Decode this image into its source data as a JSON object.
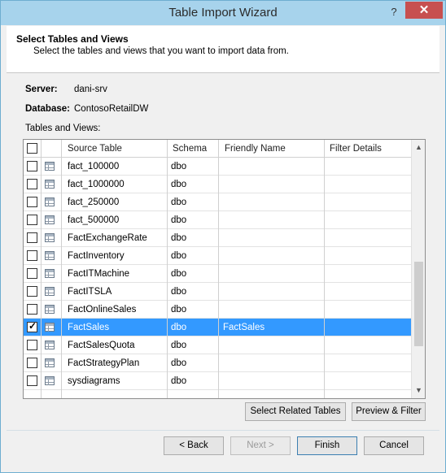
{
  "window": {
    "title": "Table Import Wizard",
    "help_glyph": "?",
    "close_glyph": "✕"
  },
  "header": {
    "title": "Select Tables and Views",
    "subtitle": "Select the tables and views that you want to import data from."
  },
  "server": {
    "label": "Server:",
    "value": "dani-srv"
  },
  "database": {
    "label": "Database:",
    "value": "ContosoRetailDW"
  },
  "tables_label": "Tables and Views:",
  "grid": {
    "columns": [
      "Source Table",
      "Schema",
      "Friendly Name",
      "Filter Details"
    ],
    "rows": [
      {
        "source": "fact_100000",
        "schema": "dbo",
        "friendly": "",
        "filter": "",
        "checked": false,
        "selected": false
      },
      {
        "source": "fact_1000000",
        "schema": "dbo",
        "friendly": "",
        "filter": "",
        "checked": false,
        "selected": false
      },
      {
        "source": "fact_250000",
        "schema": "dbo",
        "friendly": "",
        "filter": "",
        "checked": false,
        "selected": false
      },
      {
        "source": "fact_500000",
        "schema": "dbo",
        "friendly": "",
        "filter": "",
        "checked": false,
        "selected": false
      },
      {
        "source": "FactExchangeRate",
        "schema": "dbo",
        "friendly": "",
        "filter": "",
        "checked": false,
        "selected": false
      },
      {
        "source": "FactInventory",
        "schema": "dbo",
        "friendly": "",
        "filter": "",
        "checked": false,
        "selected": false
      },
      {
        "source": "FactITMachine",
        "schema": "dbo",
        "friendly": "",
        "filter": "",
        "checked": false,
        "selected": false
      },
      {
        "source": "FactITSLA",
        "schema": "dbo",
        "friendly": "",
        "filter": "",
        "checked": false,
        "selected": false
      },
      {
        "source": "FactOnlineSales",
        "schema": "dbo",
        "friendly": "",
        "filter": "",
        "checked": false,
        "selected": false
      },
      {
        "source": "FactSales",
        "schema": "dbo",
        "friendly": "FactSales",
        "filter": "",
        "checked": true,
        "selected": true
      },
      {
        "source": "FactSalesQuota",
        "schema": "dbo",
        "friendly": "",
        "filter": "",
        "checked": false,
        "selected": false
      },
      {
        "source": "FactStrategyPlan",
        "schema": "dbo",
        "friendly": "",
        "filter": "",
        "checked": false,
        "selected": false
      },
      {
        "source": "sysdiagrams",
        "schema": "dbo",
        "friendly": "",
        "filter": "",
        "checked": false,
        "selected": false
      }
    ],
    "scroll_up_glyph": "▲",
    "scroll_down_glyph": "▼"
  },
  "buttons": {
    "select_related": "Select Related Tables",
    "preview_filter": "Preview & Filter",
    "back": "< Back",
    "next": "Next >",
    "finish": "Finish",
    "cancel": "Cancel"
  }
}
